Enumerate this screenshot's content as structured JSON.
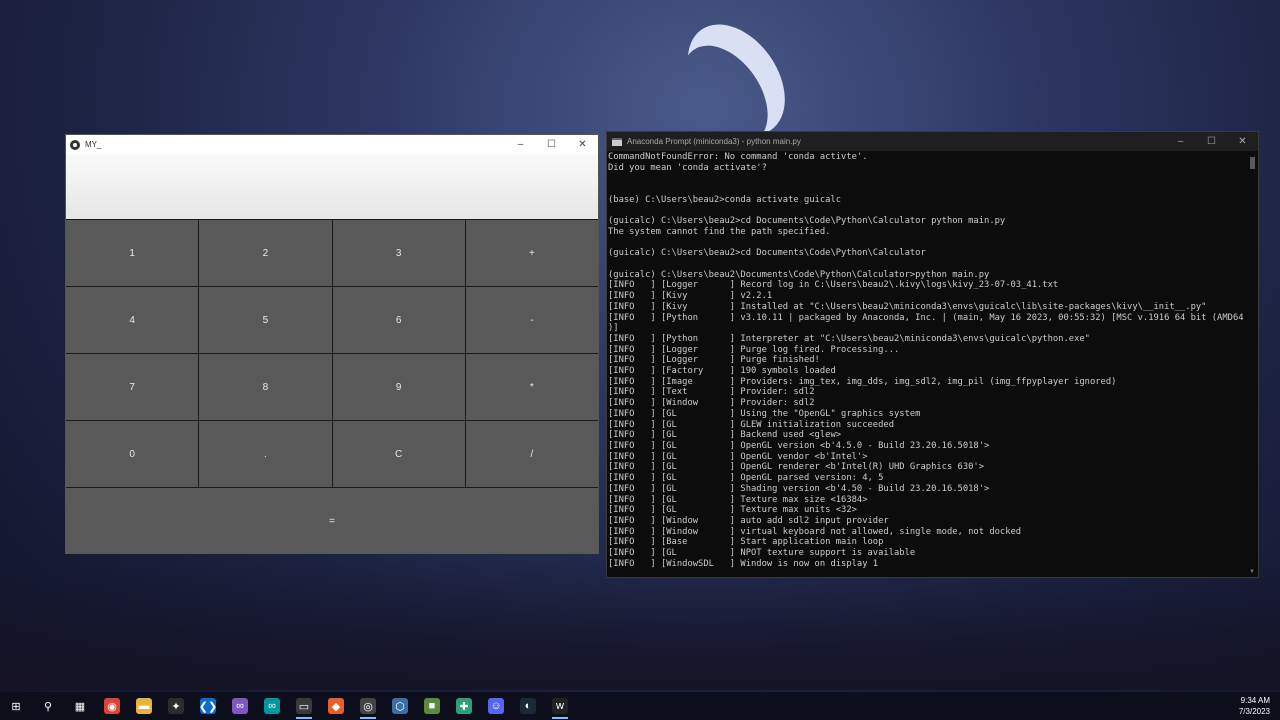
{
  "calculator": {
    "title": "MY_",
    "display": "",
    "keys": [
      "1",
      "2",
      "3",
      "+",
      "4",
      "5",
      "6",
      "-",
      "7",
      "8",
      "9",
      "*",
      "0",
      ".",
      "C",
      "/"
    ],
    "equals_label": "="
  },
  "terminal": {
    "title": "Anaconda Prompt (miniconda3) - python  main.py",
    "lines": [
      "CommandNotFoundError: No command 'conda activte'.",
      "Did you mean 'conda activate'?",
      "",
      "",
      "(base) C:\\Users\\beau2>conda activate guicalc",
      "",
      "(guicalc) C:\\Users\\beau2>cd Documents\\Code\\Python\\Calculator python main.py",
      "The system cannot find the path specified.",
      "",
      "(guicalc) C:\\Users\\beau2>cd Documents\\Code\\Python\\Calculator",
      "",
      "(guicalc) C:\\Users\\beau2\\Documents\\Code\\Python\\Calculator>python main.py",
      "[INFO   ] [Logger      ] Record log in C:\\Users\\beau2\\.kivy\\logs\\kivy_23-07-03_41.txt",
      "[INFO   ] [Kivy        ] v2.2.1",
      "[INFO   ] [Kivy        ] Installed at \"C:\\Users\\beau2\\miniconda3\\envs\\guicalc\\lib\\site-packages\\kivy\\__init__.py\"",
      "[INFO   ] [Python      ] v3.10.11 | packaged by Anaconda, Inc. | (main, May 16 2023, 00:55:32) [MSC v.1916 64 bit (AMD64",
      ")]",
      "[INFO   ] [Python      ] Interpreter at \"C:\\Users\\beau2\\miniconda3\\envs\\guicalc\\python.exe\"",
      "[INFO   ] [Logger      ] Purge log fired. Processing...",
      "[INFO   ] [Logger      ] Purge finished!",
      "[INFO   ] [Factory     ] 190 symbols loaded",
      "[INFO   ] [Image       ] Providers: img_tex, img_dds, img_sdl2, img_pil (img_ffpyplayer ignored)",
      "[INFO   ] [Text        ] Provider: sdl2",
      "[INFO   ] [Window      ] Provider: sdl2",
      "[INFO   ] [GL          ] Using the \"OpenGL\" graphics system",
      "[INFO   ] [GL          ] GLEW initialization succeeded",
      "[INFO   ] [GL          ] Backend used <glew>",
      "[INFO   ] [GL          ] OpenGL version <b'4.5.0 - Build 23.20.16.5018'>",
      "[INFO   ] [GL          ] OpenGL vendor <b'Intel'>",
      "[INFO   ] [GL          ] OpenGL renderer <b'Intel(R) UHD Graphics 630'>",
      "[INFO   ] [GL          ] OpenGL parsed version: 4, 5",
      "[INFO   ] [GL          ] Shading version <b'4.50 - Build 23.20.16.5018'>",
      "[INFO   ] [GL          ] Texture max size <16384>",
      "[INFO   ] [GL          ] Texture max units <32>",
      "[INFO   ] [Window      ] auto add sdl2 input provider",
      "[INFO   ] [Window      ] virtual keyboard not allowed, single mode, not docked",
      "[INFO   ] [Base        ] Start application main loop",
      "[INFO   ] [GL          ] NPOT texture support is available",
      "[INFO   ] [WindowSDL   ] Window is now on display 1"
    ]
  },
  "taskbar": {
    "icons": [
      {
        "name": "windows-start-icon",
        "glyph": "⊞",
        "color": "#0c0e1c"
      },
      {
        "name": "search-icon",
        "glyph": "⚲",
        "color": "#0c0e1c"
      },
      {
        "name": "task-view-icon",
        "glyph": "▦",
        "color": "#0c0e1c"
      },
      {
        "name": "chrome-icon",
        "glyph": "◉",
        "color": "#db4437"
      },
      {
        "name": "file-explorer-icon",
        "glyph": "▬",
        "color": "#e8b339"
      },
      {
        "name": "game-app-icon",
        "glyph": "✦",
        "color": "#2b2b2b"
      },
      {
        "name": "vscode-icon",
        "glyph": "❮❯",
        "color": "#0a6ed1"
      },
      {
        "name": "visual-studio-icon",
        "glyph": "∞",
        "color": "#7e57c2"
      },
      {
        "name": "arduino-icon",
        "glyph": "∞",
        "color": "#00979c"
      },
      {
        "name": "terminal-icon",
        "glyph": "▭",
        "color": "#3a3a3a"
      },
      {
        "name": "git-icon",
        "glyph": "◆",
        "color": "#e85f2c"
      },
      {
        "name": "obs-icon",
        "glyph": "◎",
        "color": "#444444"
      },
      {
        "name": "cube-app-icon",
        "glyph": "⬡",
        "color": "#3b6ea5"
      },
      {
        "name": "minecraft-icon",
        "glyph": "■",
        "color": "#5c8a3a"
      },
      {
        "name": "circle-app-icon",
        "glyph": "✚",
        "color": "#2f9e7a"
      },
      {
        "name": "discord-icon",
        "glyph": "☺",
        "color": "#5865f2"
      },
      {
        "name": "steam-icon",
        "glyph": "◐",
        "color": "#1b2838"
      },
      {
        "name": "kivy-app-icon",
        "glyph": "w",
        "color": "#222222"
      }
    ],
    "time": "9:34 AM",
    "date": "7/3/2023"
  }
}
